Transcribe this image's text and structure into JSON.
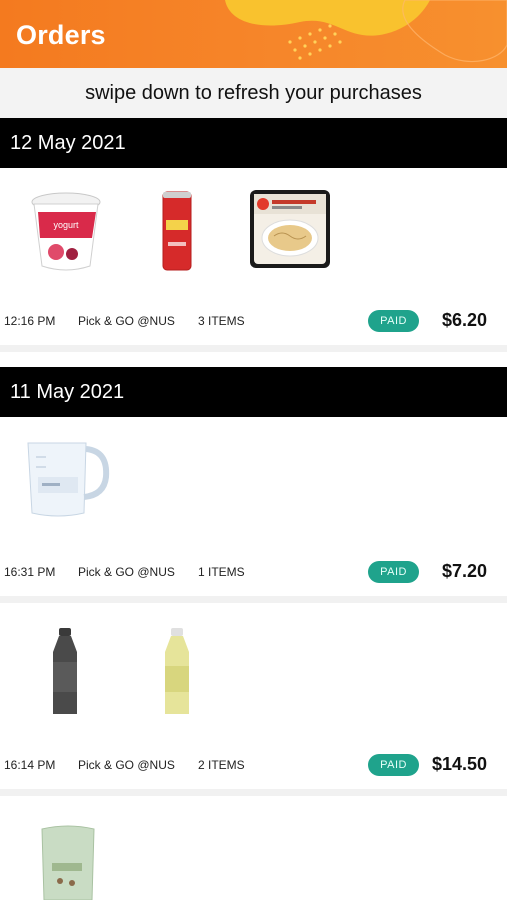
{
  "header": {
    "title": "Orders"
  },
  "refresh_hint": "swipe down to refresh your purchases",
  "groups": [
    {
      "date": "12 May 2021",
      "orders": [
        {
          "time": "12:16 PM",
          "store": "Pick & GO @NUS",
          "items": "3 ITEMS",
          "status": "PAID",
          "amount": "$6.20",
          "products": [
            "yogurt-cup",
            "schweppes-can",
            "spaghetti-meal-box"
          ]
        }
      ]
    },
    {
      "date": "11 May 2021",
      "orders": [
        {
          "time": "16:31 PM",
          "store": "Pick & GO @NUS",
          "items": "1 ITEMS",
          "status": "PAID",
          "amount": "$7.20",
          "products": [
            "measuring-jug"
          ]
        },
        {
          "time": "16:14 PM",
          "store": "Pick & GO @NUS",
          "items": "2 ITEMS",
          "status": "PAID",
          "amount": "$14.50",
          "products": [
            "dark-bottle",
            "juice-bottle"
          ]
        },
        {
          "products": [
            "green-pouch"
          ]
        }
      ]
    }
  ],
  "colors": {
    "brand_orange": "#f47a1f",
    "paid_green": "#1fa38c",
    "date_bar": "#000000"
  }
}
